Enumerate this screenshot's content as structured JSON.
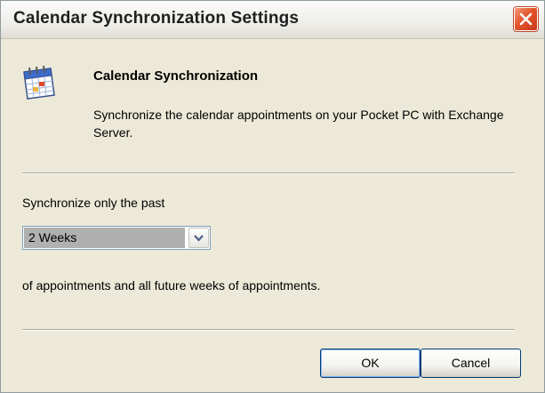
{
  "window": {
    "title": "Calendar Synchronization Settings",
    "close_icon": "close-icon"
  },
  "header": {
    "icon": "calendar-icon",
    "title": "Calendar Synchronization",
    "description": "Synchronize the calendar appointments on your Pocket PC with Exchange Server."
  },
  "sync": {
    "label": "Synchronize only the past",
    "selected_value": "2 Weeks",
    "after_label": "of appointments and all future weeks of appointments."
  },
  "buttons": {
    "ok_label": "OK",
    "cancel_label": "Cancel"
  },
  "colors": {
    "dialog_background": "#ece9d8",
    "close_button": "#e3542a",
    "button_border": "#003c74"
  }
}
